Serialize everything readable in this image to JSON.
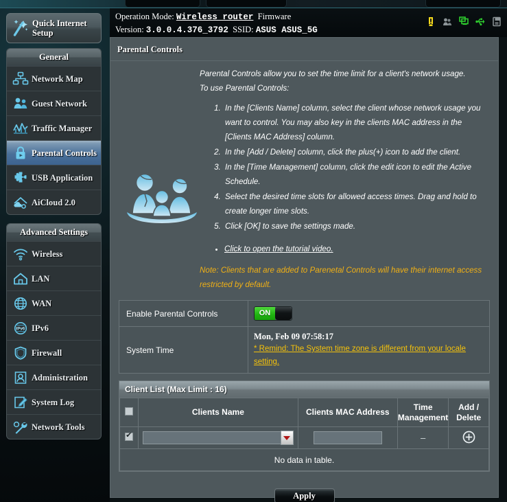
{
  "header": {
    "operation_mode_label": "Operation Mode:",
    "operation_mode_value": "Wireless router",
    "firmware_label": "Firmware Version:",
    "firmware_version": "3.0.0.4.376_3792",
    "ssid_label": "SSID:",
    "ssid_value": "ASUS ASUS_5G",
    "icons": [
      {
        "name": "notification-icon",
        "color": "#f4d91b"
      },
      {
        "name": "guest-network-icon",
        "color": "#8e9699"
      },
      {
        "name": "client-status-icon",
        "color": "#2ecc2e"
      },
      {
        "name": "usb-device-icon",
        "color": "#2ecc2e"
      },
      {
        "name": "printer-server-icon",
        "color": "#8e9699"
      }
    ]
  },
  "sidebar": {
    "quick_setup_label": "Quick Internet Setup",
    "general_label": "General",
    "advanced_label": "Advanced Settings",
    "general_items": [
      {
        "label": "Network Map",
        "icon": "network-map-icon",
        "active": false
      },
      {
        "label": "Guest Network",
        "icon": "guest-network-icon",
        "active": false
      },
      {
        "label": "Traffic Manager",
        "icon": "traffic-manager-icon",
        "active": false
      },
      {
        "label": "Parental Controls",
        "icon": "parental-controls-lock-icon",
        "active": true
      },
      {
        "label": "USB Application",
        "icon": "usb-application-icon",
        "active": false
      },
      {
        "label": "AiCloud 2.0",
        "icon": "aicloud-icon",
        "active": false
      }
    ],
    "advanced_items": [
      {
        "label": "Wireless",
        "icon": "wireless-signal-icon",
        "active": false
      },
      {
        "label": "LAN",
        "icon": "home-icon",
        "active": false
      },
      {
        "label": "WAN",
        "icon": "globe-icon",
        "active": false
      },
      {
        "label": "IPv6",
        "icon": "ipv6-globe-icon",
        "active": false
      },
      {
        "label": "Firewall",
        "icon": "shield-icon",
        "active": false
      },
      {
        "label": "Administration",
        "icon": "user-admin-icon",
        "active": false
      },
      {
        "label": "System Log",
        "icon": "pencil-note-icon",
        "active": false
      },
      {
        "label": "Network Tools",
        "icon": "wrench-icon",
        "active": false
      }
    ]
  },
  "main": {
    "page_title": "Parental Controls",
    "intro_line1": "Parental Controls allow you to set the time limit for a client's network usage.",
    "intro_line2": "To use Parental Controls:",
    "steps": [
      "In the [Clients Name] column, select the client whose network usage you want to control. You may also key in the clients MAC address in the [Clients MAC Address] column.",
      "In the [Add / Delete] column, click the plus(+) icon to add the client.",
      "In the [Time Management] column, click the edit icon to edit the Active Schedule.",
      "Select the desired time slots for allowed access times. Drag and hold to create longer time slots.",
      "Click [OK] to save the settings made."
    ],
    "tutorial_link": "Click to open the tutorial video.",
    "note": "Note: Clients that are added to Parenetal Controls will have their internet access restricted by default.",
    "family_icon": "family-illustration-icon",
    "settings": {
      "enable_label": "Enable Parental Controls",
      "enable_state": "ON",
      "system_time_label": "System Time",
      "system_time_value": "Mon, Feb 09  07:58:17",
      "system_time_remind": "* Remind: The System time zone is different from your locale setting."
    },
    "client_list": {
      "title": "Client List (Max Limit : 16)",
      "columns": [
        "",
        "Clients Name",
        "Clients MAC Address",
        "Time Management",
        "Add / Delete"
      ],
      "row": {
        "checked": true,
        "client_name_value": "",
        "mac_value": "",
        "mac_placeholder": "",
        "time_management": "–",
        "add_icon": "plus-circle-icon"
      },
      "empty_message": "No data in table."
    },
    "apply_label": "Apply"
  }
}
